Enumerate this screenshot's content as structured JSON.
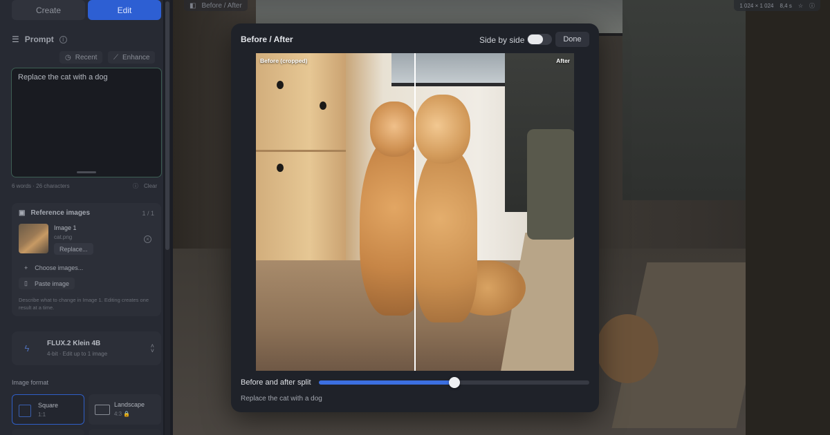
{
  "sidebar": {
    "tabs": {
      "create": "Create",
      "edit": "Edit"
    },
    "prompt": {
      "title": "Prompt",
      "recent": "Recent",
      "enhance": "Enhance",
      "value": "Replace the cat with a dog",
      "counts": "6 words · 26 characters",
      "clear": "Clear"
    },
    "reference": {
      "title": "Reference images",
      "count": "1 / 1",
      "image_name": "Image 1",
      "image_file": "cat.png",
      "replace": "Replace...",
      "choose": "Choose images...",
      "paste": "Paste image",
      "hint": "Describe what to change in Image 1. Editing creates one result at a time."
    },
    "model": {
      "name": "FLUX.2 Klein 4B",
      "subtitle": "4-bit · Edit up to 1 image"
    },
    "format": {
      "label": "Image format",
      "options": [
        {
          "name": "Square",
          "ratio": "1:1"
        },
        {
          "name": "Landscape",
          "ratio": "4:3 🔒"
        }
      ]
    }
  },
  "canvas": {
    "view_label": "Before / After",
    "size": "1 024 × 1 024",
    "time": "8,4 s"
  },
  "modal": {
    "title": "Before / After",
    "toggle_label": "Side by side",
    "toggle_on": false,
    "done": "Done",
    "tag_before": "Before (cropped)",
    "tag_after": "After",
    "split_label": "Before and after split",
    "split_value": 0.5,
    "caption": "Replace the cat with a dog"
  },
  "colors": {
    "accent": "#2d5fd3",
    "slider_fill": "#3c6fe0",
    "focus_ring": "#3d5f54"
  }
}
